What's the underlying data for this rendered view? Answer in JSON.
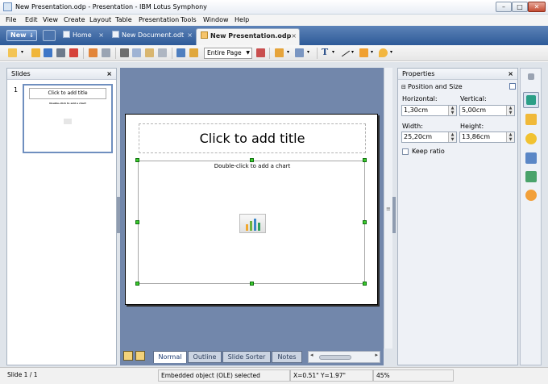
{
  "window": {
    "title": "New Presentation.odp - Presentation - IBM Lotus Symphony",
    "minimize": "–",
    "maximize": "□",
    "close": "✕"
  },
  "menu": [
    "File",
    "Edit",
    "View",
    "Create",
    "Layout",
    "Table",
    "Presentation",
    "Tools",
    "Window",
    "Help"
  ],
  "tabs": {
    "new_label": "New",
    "new_arrow": "↓",
    "items": [
      {
        "label": "Home",
        "close": "×",
        "icon": "home-icon"
      },
      {
        "label": "New Document.odt",
        "close": "×",
        "icon": "document-icon"
      },
      {
        "label": "New Presentation.odp",
        "close": "×",
        "icon": "presentation-icon",
        "active": true
      }
    ]
  },
  "toolbar": {
    "zoom_value": "Entire Page",
    "zoom_arrow": "▼",
    "text_tool_glyph": "T",
    "dropdown_glyph": "▾"
  },
  "slides_panel": {
    "title": "Slides",
    "close": "×",
    "slide_number": "1",
    "thumb_title": "Click to add title",
    "thumb_subtitle": "Double-click to add a chart"
  },
  "slide": {
    "title_placeholder": "Click to add title",
    "chart_placeholder": "Double-click to add a chart"
  },
  "views": {
    "tabs": [
      "Normal",
      "Outline",
      "Slide Sorter",
      "Notes"
    ],
    "active": "Normal",
    "scroll_left": "◂",
    "scroll_right": "▸"
  },
  "editor": {
    "scroll_grip": "≡"
  },
  "properties": {
    "title": "Properties",
    "close": "×",
    "section": "Position and Size",
    "section_toggle": "▬",
    "horizontal_label": "Horizontal:",
    "horizontal_value": "1,30cm",
    "vertical_label": "Vertical:",
    "vertical_value": "5,00cm",
    "width_label": "Width:",
    "width_value": "25,20cm",
    "height_label": "Height:",
    "height_value": "13,86cm",
    "keep_ratio_label": "Keep ratio",
    "spin_up": "▲",
    "spin_down": "▼"
  },
  "sidebar": {
    "icons": [
      "pin-icon",
      "properties-icon",
      "chart-icon",
      "star-icon",
      "navigator-icon",
      "styles-icon",
      "compass-icon"
    ]
  },
  "status": {
    "slide": "Slide 1 / 1",
    "selection": "Embedded object (OLE) selected",
    "position": "X=0.51\" Y=1.97\"",
    "zoom": "45%"
  },
  "colors": {
    "tab_bar": "#2d5a98",
    "editor_background": "#7287ab",
    "handle": "#3dcb2d",
    "chart_bars": [
      "#f0a830",
      "#6cb33f",
      "#3a86c8",
      "#2f9e5e"
    ]
  }
}
